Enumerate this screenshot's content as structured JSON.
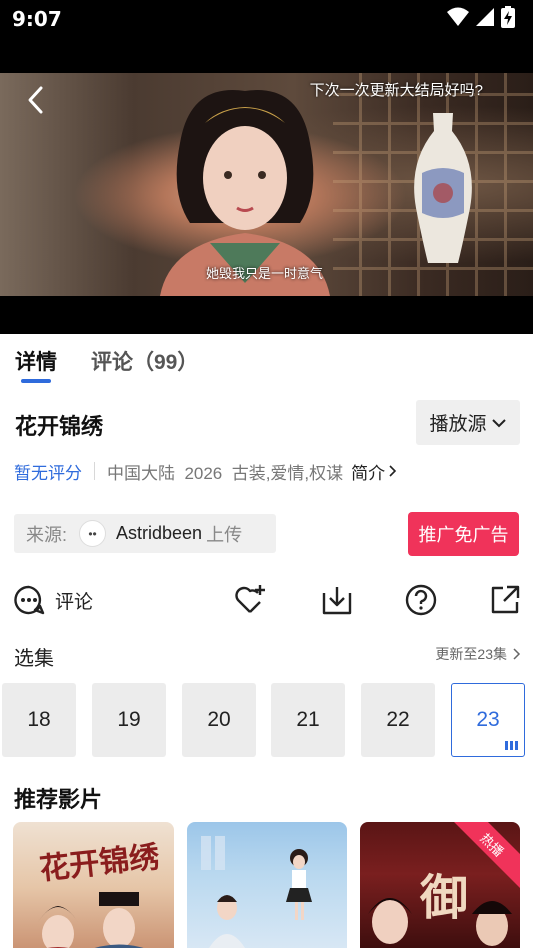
{
  "status_bar": {
    "time": "9:07"
  },
  "player": {
    "subtitle_top": "下次一次更新大结局好吗?",
    "subtitle_bottom": "她毁我只是一时意气"
  },
  "tabs": [
    {
      "label": "详情",
      "active": true
    },
    {
      "label": "评论（99）",
      "active": false
    }
  ],
  "show": {
    "title": "花开锦绣",
    "source_button": "播放源",
    "rating": "暂无评分",
    "info": "中国大陆  2026  古装,爱情,权谋",
    "intro_label": "简介"
  },
  "uploader": {
    "prefix": "来源:",
    "name": "Astridbeen",
    "suffix": "上传",
    "avatar_text": "••"
  },
  "promo_button": "推广免广告",
  "actions": {
    "comment_label": "评论",
    "icons": [
      "comment-icon",
      "favorite-add-icon",
      "download-icon",
      "help-icon",
      "share-icon"
    ]
  },
  "episodes": {
    "header": "选集",
    "update_status": "更新至23集",
    "items": [
      "18",
      "19",
      "20",
      "21",
      "22",
      "23"
    ],
    "active": "23"
  },
  "recommendations": {
    "title": "推荐影片",
    "posters": [
      {
        "calligraphy": "花开锦绣"
      },
      {
        "calligraphy": ""
      },
      {
        "calligraphy": "御",
        "badge": "热播"
      }
    ]
  },
  "colors": {
    "accent": "#2f6bdc",
    "promo": "#f0335a",
    "chip_bg": "#efefef"
  }
}
